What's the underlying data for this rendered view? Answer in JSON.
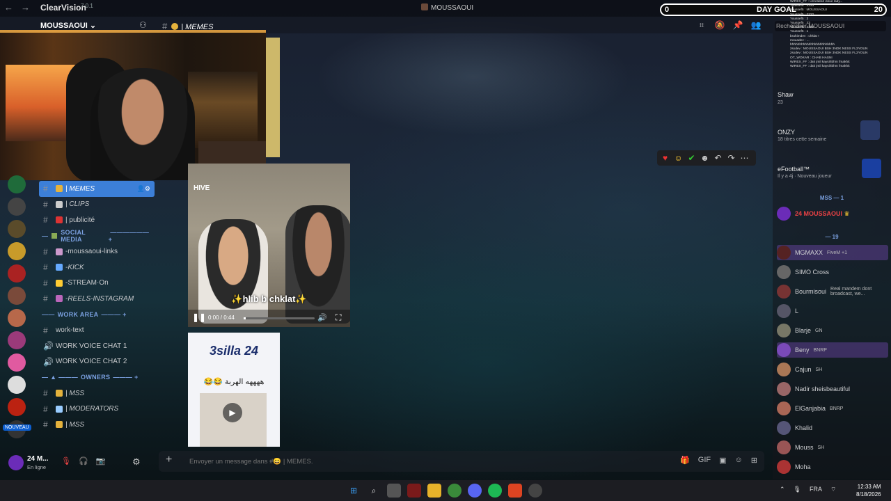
{
  "titlebar": {
    "app_name": "ClearVision",
    "version": "7.0.1",
    "window_title": "MOUSSAOUI"
  },
  "header": {
    "server_name": "MOUSSAOUI",
    "channel": "| MEMES"
  },
  "day_goal": {
    "start": "0",
    "label": "DAY GOAL",
    "target": "20",
    "progress": 0
  },
  "channels": [
    {
      "type": "channel",
      "label": "| MEMES",
      "active": true,
      "italic": true
    },
    {
      "type": "channel",
      "label": "| CLIPS",
      "italic": true
    },
    {
      "type": "channel",
      "label": "| publicité"
    },
    {
      "type": "category",
      "label": "SOCIAL MEDIA"
    },
    {
      "type": "channel",
      "label": "-moussaoui-links"
    },
    {
      "type": "channel",
      "label": "-KICK",
      "italic": true
    },
    {
      "type": "channel",
      "label": "-STREAM·On"
    },
    {
      "type": "channel",
      "label": "-REELS-INSTAGRAM",
      "italic": true
    },
    {
      "type": "category",
      "label": "WORK AREA"
    },
    {
      "type": "channel",
      "label": "work-text"
    },
    {
      "type": "voice",
      "label": "WORK VOICE CHAT 1"
    },
    {
      "type": "voice",
      "label": "WORK VOICE CHAT 2"
    },
    {
      "type": "category",
      "label": "OWNERS"
    },
    {
      "type": "channel",
      "label": "| MSS",
      "italic": true
    },
    {
      "type": "channel",
      "label": "| MODERATORS",
      "italic": true
    },
    {
      "type": "channel",
      "label": "| MSS",
      "italic": true
    }
  ],
  "rail": {
    "new_badge": "NOUVEAU"
  },
  "video": {
    "caption": "✨hlib b chklat✨",
    "time": "0:00 / 0:44",
    "progress": 0.03,
    "overlay_text": "HIVE"
  },
  "thumbnail": {
    "title": "3silla 24",
    "subtitle": "😂😂 ههههه الهربة"
  },
  "activity": {
    "search_placeholder": "Rechercher MOUSSAOUI",
    "item1_name": "Shaw",
    "item1_sub": "23",
    "item2_name": "ONZY",
    "item2_sub": "18 titres cette semaine",
    "item3_name": "eFootball™",
    "item3_sub": "Il y a 4j · Nouveau joueur"
  },
  "members": {
    "group1": "MSS — 1",
    "owner": "24 MOUSSAOUI",
    "group2": "— 19",
    "list": [
      {
        "name": "MGMAXX",
        "sub": "FiveM +1",
        "hl": true
      },
      {
        "name": "SIMO Cross"
      },
      {
        "name": "Bourmisoui",
        "sub": "Real mandem dont broadcast, we..."
      },
      {
        "name": "L"
      },
      {
        "name": "Blarje",
        "tag": "GN"
      },
      {
        "name": "Beny",
        "tag": "BNRP",
        "hl": true
      },
      {
        "name": "Cajun",
        "tag": "SH"
      },
      {
        "name": "Nadir sheisbeautiful"
      },
      {
        "name": "ElGanjabia",
        "tag": "BNRP"
      },
      {
        "name": "Khalid"
      },
      {
        "name": "Mouss",
        "tag": "SH"
      },
      {
        "name": "Moha"
      }
    ]
  },
  "chat_overlay": [
    "WIREX_FF : Unrelated issue lady...",
    "Youssef5 : 3333",
    "Youssef5 : MOUSSAOUI",
    "Youssef5 : 2222",
    "Youssef5 : 3",
    "Youssef5 : 33",
    "Youssef5 : 3333",
    "Youssef5 : 1",
    "brahimdev : chklat !",
    "mouadev : ...",
    "hhhhhhhhhhhhhhhhhhhhhhhh",
    "zsxdev : MOUSSAOUI BSH 3NDK NESS FL3YOUN",
    "zsxdev : MOUSSAOUI BSH 3NDK NESS FL3YOUN",
    "OT_WOKAR : CHAB HASNI",
    "WIREX_FF : dak jmil kaysihbhm fmakhit",
    "WIREX_FF : dak jmil kaysihbhm fmakhit"
  ],
  "composer": {
    "placeholder": "Envoyer un message dans #😄 | MEMES."
  },
  "user": {
    "name": "24 M...",
    "status": "En ligne"
  },
  "taskbar": {
    "lang": "FRA",
    "time": "12:33 AM",
    "date": "8/18/2026"
  },
  "colors": {
    "accent": "#3c7fd8",
    "danger": "#ed4245",
    "category": "#7aa0e0"
  }
}
